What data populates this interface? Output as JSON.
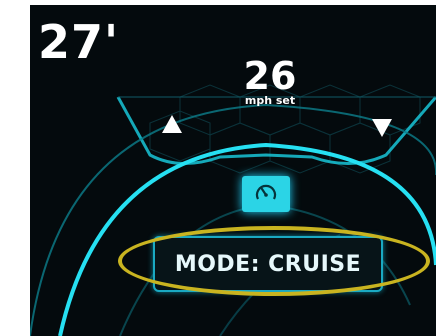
{
  "depth": {
    "value": "27'"
  },
  "speed": {
    "value": "26",
    "unit": "mph set"
  },
  "controls": {
    "increase_icon": "triangle-up",
    "decrease_icon": "triangle-down",
    "cruise_icon": "speedometer-icon"
  },
  "mode": {
    "label": "MODE: CRUISE"
  },
  "colors": {
    "accent": "#2bd4e6",
    "background": "#040a0d",
    "highlight": "#c9b420",
    "text": "#ffffff"
  }
}
